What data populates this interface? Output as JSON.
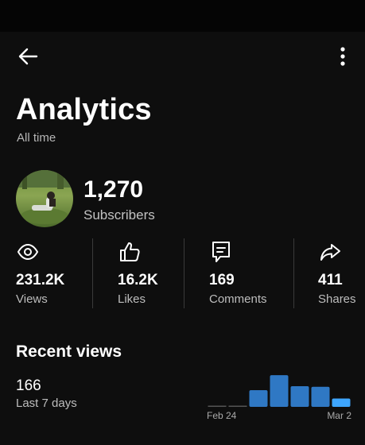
{
  "header": {
    "title": "Analytics",
    "subtitle": "All time",
    "back_icon": "back-arrow-icon",
    "menu_icon": "more-vert-icon"
  },
  "channel": {
    "subscribers_value": "1,270",
    "subscribers_label": "Subscribers"
  },
  "stats": [
    {
      "icon": "eye-icon",
      "value": "231.2K",
      "label": "Views"
    },
    {
      "icon": "thumbs-up-icon",
      "value": "16.2K",
      "label": "Likes"
    },
    {
      "icon": "comment-icon",
      "value": "169",
      "label": "Comments"
    },
    {
      "icon": "share-icon",
      "value": "411",
      "label": "Shares"
    }
  ],
  "recent": {
    "title": "Recent views",
    "value": "166",
    "label": "Last 7 days"
  },
  "chart_data": {
    "type": "bar",
    "title": "",
    "x_tick_labels": [
      "Feb 24",
      "Mar 2"
    ],
    "relative_values": [
      0,
      0,
      0.5,
      0.95,
      0.62,
      0.6,
      0.25
    ],
    "colors": {
      "bar": "#2f78c4",
      "bar_highlight": "#3ea6ff",
      "baseline": "#555555"
    },
    "grid": false,
    "legend": "none"
  },
  "colors": {
    "background": "#0e0e0e",
    "accent": "#3ea6ff"
  }
}
